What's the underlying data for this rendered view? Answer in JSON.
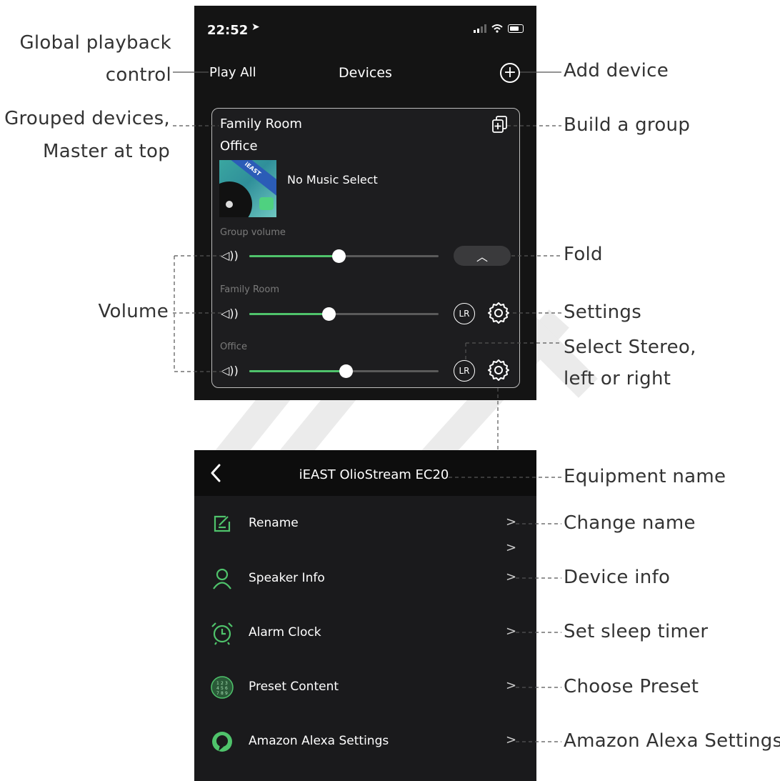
{
  "screen_devices": {
    "status": {
      "time": "22:52"
    },
    "nav": {
      "left": "Play All",
      "title": "Devices"
    },
    "group": {
      "master": "Family Room",
      "member": "Office",
      "now_playing": "No Music Select",
      "album_brand": "iEAST"
    },
    "volumes": [
      {
        "label": "Group volume",
        "level": 0.47
      },
      {
        "label": "Family Room",
        "level": 0.42
      },
      {
        "label": "Office",
        "level": 0.51
      }
    ],
    "stereo_label": "LR"
  },
  "screen_settings": {
    "title": "iEAST OlioStream EC20",
    "menu": [
      {
        "label": "Rename",
        "icon": "rename-icon"
      },
      {
        "label": "Speaker Info",
        "icon": "person-icon"
      },
      {
        "label": "Alarm Clock",
        "icon": "alarm-clock-icon"
      },
      {
        "label": "Preset Content",
        "icon": "preset-grid-icon"
      },
      {
        "label": "Amazon Alexa Settings",
        "icon": "alexa-icon"
      }
    ]
  },
  "annotations": {
    "global_playback_1": "Global playback",
    "global_playback_2": "control",
    "grouped_1": "Grouped devices,",
    "grouped_2": "Master at top",
    "volume": "Volume",
    "add_device": "Add device",
    "build_group": "Build a group",
    "fold": "Fold",
    "settings": "Settings",
    "stereo_1": "Select Stereo,",
    "stereo_2": "left or right",
    "equipment_name": "Equipment name",
    "change_name": "Change name",
    "device_info": "Device info",
    "sleep_timer": "Set sleep timer",
    "choose_preset": "Choose Preset",
    "alexa": "Amazon Alexa Settings"
  },
  "colors": {
    "accent_green": "#4fc36b",
    "screen_bg": "#141414"
  }
}
